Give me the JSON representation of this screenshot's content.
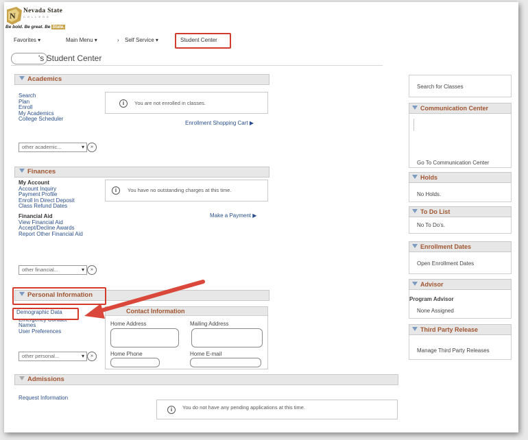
{
  "brand": {
    "name": "Nevada State",
    "sub": "COLLEGE",
    "tagline": "Be bold. Be great. Be",
    "tagline_highlight": "State."
  },
  "nav": {
    "favorites": "Favorites ▾",
    "main_menu": "Main Menu ▾",
    "sep": "›",
    "self_service": "Self Service ▾",
    "student_center": "Student Center"
  },
  "page": {
    "title": "'s Student Center"
  },
  "academics": {
    "header": "Academics",
    "links": [
      "Search",
      "Plan",
      "Enroll",
      "My Academics",
      "College Scheduler"
    ],
    "message": "You are not enrolled in classes.",
    "cart": "Enrollment Shopping Cart ▶",
    "select": "other academic..."
  },
  "finances": {
    "header": "Finances",
    "my_account": "My Account",
    "account_links": [
      "Account Inquiry",
      "Payment Profile",
      "Enroll In Direct Deposit",
      "Class Refund Dates"
    ],
    "financial_aid": "Financial Aid",
    "aid_links": [
      "View Financial Aid",
      "Accept/Decline Awards",
      "Report Other Financial Aid"
    ],
    "message": "You have no outstanding charges at this time.",
    "payment": "Make a Payment ▶",
    "select": "other financial..."
  },
  "personal": {
    "header": "Personal Information",
    "links": [
      "Demographic Data",
      "Emergency Contact",
      "Names",
      "User Preferences"
    ],
    "contact_header": "Contact Information",
    "home_address": "Home Address",
    "mailing_address": "Mailing Address",
    "home_phone": "Home Phone",
    "home_email": "Home E-mail",
    "select": "other personal..."
  },
  "admissions": {
    "header": "Admissions",
    "link": "Request Information",
    "message": "You do not have any pending applications at this time."
  },
  "sidebar": {
    "search_classes": "Search for Classes",
    "comm_header": "Communication Center",
    "comm_link": "Go To Communication Center",
    "holds_header": "Holds",
    "holds_text": "No Holds.",
    "todo_header": "To Do List",
    "todo_text": "No To Do's.",
    "enroll_header": "Enrollment Dates",
    "enroll_link": "Open Enrollment Dates",
    "advisor_header": "Advisor",
    "advisor_label": "Program Advisor",
    "advisor_value": "None Assigned",
    "third_header": "Third Party Release",
    "third_link": "Manage Third Party Releases"
  },
  "colors": {
    "section_title": "#a05530",
    "link": "#2a4f8a",
    "highlight": "#d23a2b"
  }
}
